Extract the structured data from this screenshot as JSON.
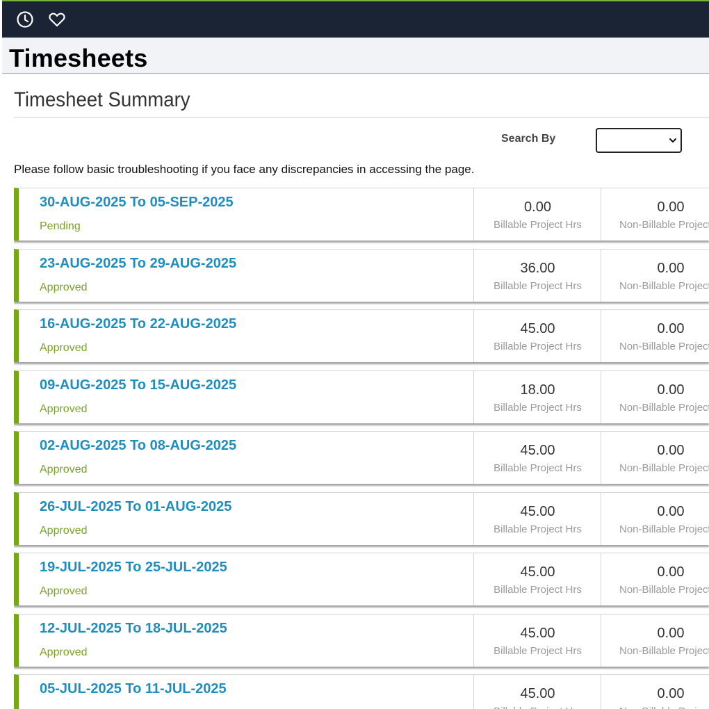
{
  "header": {
    "icons": [
      "clock-icon",
      "heart-icon"
    ]
  },
  "page": {
    "title": "Timesheets"
  },
  "summary": {
    "title": "Timesheet Summary",
    "search_label": "Search By",
    "search_value": "",
    "notice": "Please follow basic troubleshooting if you face any discrepancies in accessing the page."
  },
  "labels": {
    "billable": "Billable Project Hrs",
    "nonbillable": "Non-Billable Project Hrs"
  },
  "timesheets": [
    {
      "period": "30-AUG-2025 To 05-SEP-2025",
      "status": "Pending",
      "billable": "0.00",
      "nonbillable": "0.00"
    },
    {
      "period": "23-AUG-2025 To 29-AUG-2025",
      "status": "Approved",
      "billable": "36.00",
      "nonbillable": "0.00"
    },
    {
      "period": "16-AUG-2025 To 22-AUG-2025",
      "status": "Approved",
      "billable": "45.00",
      "nonbillable": "0.00"
    },
    {
      "period": "09-AUG-2025 To 15-AUG-2025",
      "status": "Approved",
      "billable": "18.00",
      "nonbillable": "0.00"
    },
    {
      "period": "02-AUG-2025 To 08-AUG-2025",
      "status": "Approved",
      "billable": "45.00",
      "nonbillable": "0.00"
    },
    {
      "period": "26-JUL-2025 To 01-AUG-2025",
      "status": "Approved",
      "billable": "45.00",
      "nonbillable": "0.00"
    },
    {
      "period": "19-JUL-2025 To 25-JUL-2025",
      "status": "Approved",
      "billable": "45.00",
      "nonbillable": "0.00"
    },
    {
      "period": "12-JUL-2025 To 18-JUL-2025",
      "status": "Approved",
      "billable": "45.00",
      "nonbillable": "0.00"
    },
    {
      "period": "05-JUL-2025 To 11-JUL-2025",
      "status": "",
      "billable": "45.00",
      "nonbillable": "0.00"
    }
  ],
  "colors": {
    "topbar": "#1b2434",
    "accent_green": "#74a817",
    "link_blue": "#1f8ebf",
    "status_green": "#78a326"
  }
}
